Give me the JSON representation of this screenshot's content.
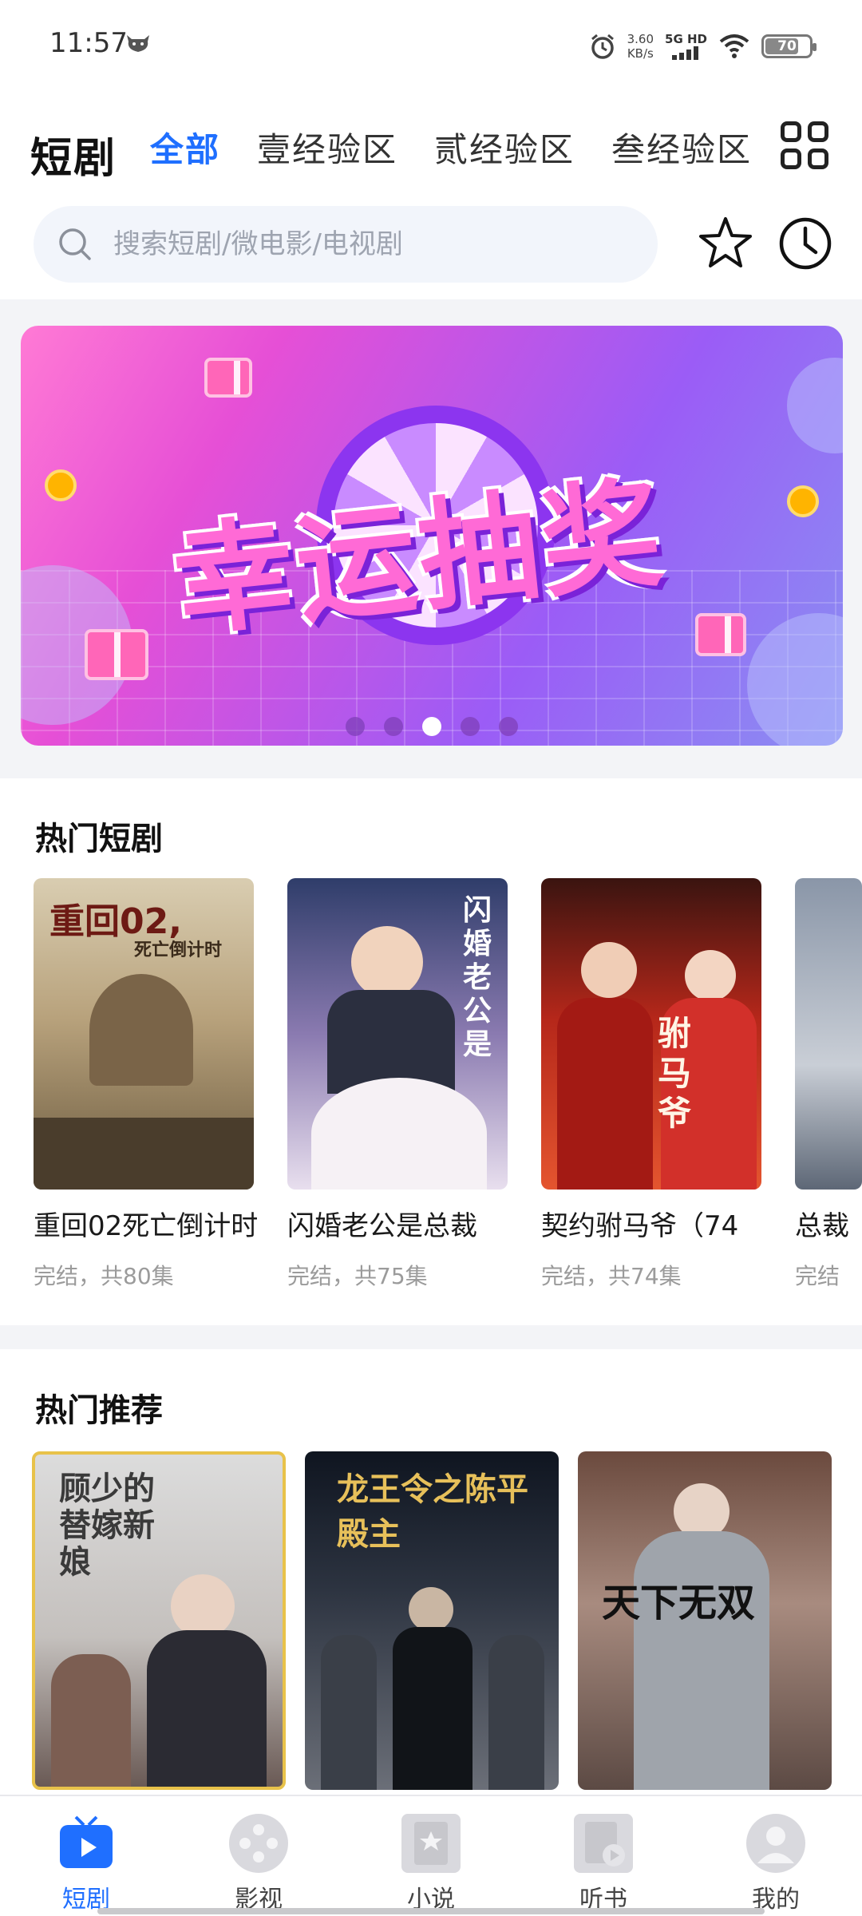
{
  "status_bar": {
    "time": "11:57",
    "speed_value": "3.60",
    "speed_unit": "KB/s",
    "network": "5G HD",
    "battery": "70",
    "battery_level": 0.7
  },
  "header": {
    "brand": "短剧",
    "tabs": [
      {
        "label": "全部",
        "active": true
      },
      {
        "label": "壹经验区",
        "active": false
      },
      {
        "label": "贰经验区",
        "active": false
      },
      {
        "label": "叁经验区",
        "active": false
      }
    ]
  },
  "search": {
    "placeholder": "搜索短剧/微电影/电视剧"
  },
  "banner": {
    "title": "幸运抽奖",
    "slide_count": 5,
    "active_slide": 3
  },
  "hot_dramas": {
    "title": "热门短剧",
    "items": [
      {
        "title": "重回02死亡倒计时",
        "sub": "完结，共80集",
        "poster_text": "重回02,",
        "poster_sub": "死亡倒计时"
      },
      {
        "title": "闪婚老公是总裁",
        "sub": "完结，共75集",
        "poster_text": "闪婚老公是"
      },
      {
        "title": "契约驸马爷（74",
        "sub": "完结，共74集",
        "poster_text": "驸马爷"
      },
      {
        "title": "总裁",
        "sub": "完结"
      }
    ]
  },
  "recommend": {
    "title": "热门推荐",
    "items": [
      {
        "poster_text": "顾少的替嫁新娘"
      },
      {
        "poster_text": "龙王令之陈平殿主"
      },
      {
        "poster_text": "天下无双"
      }
    ]
  },
  "bottom_nav": [
    {
      "label": "短剧",
      "icon": "tv-icon",
      "active": true
    },
    {
      "label": "影视",
      "icon": "film-reel-icon",
      "active": false
    },
    {
      "label": "小说",
      "icon": "book-icon",
      "active": false
    },
    {
      "label": "听书",
      "icon": "audiobook-icon",
      "active": false
    },
    {
      "label": "我的",
      "icon": "profile-icon",
      "active": false
    }
  ],
  "colors": {
    "accent": "#1f6fff",
    "banner_pink": "#ff6ad6",
    "banner_purple": "#9b5cf6"
  }
}
